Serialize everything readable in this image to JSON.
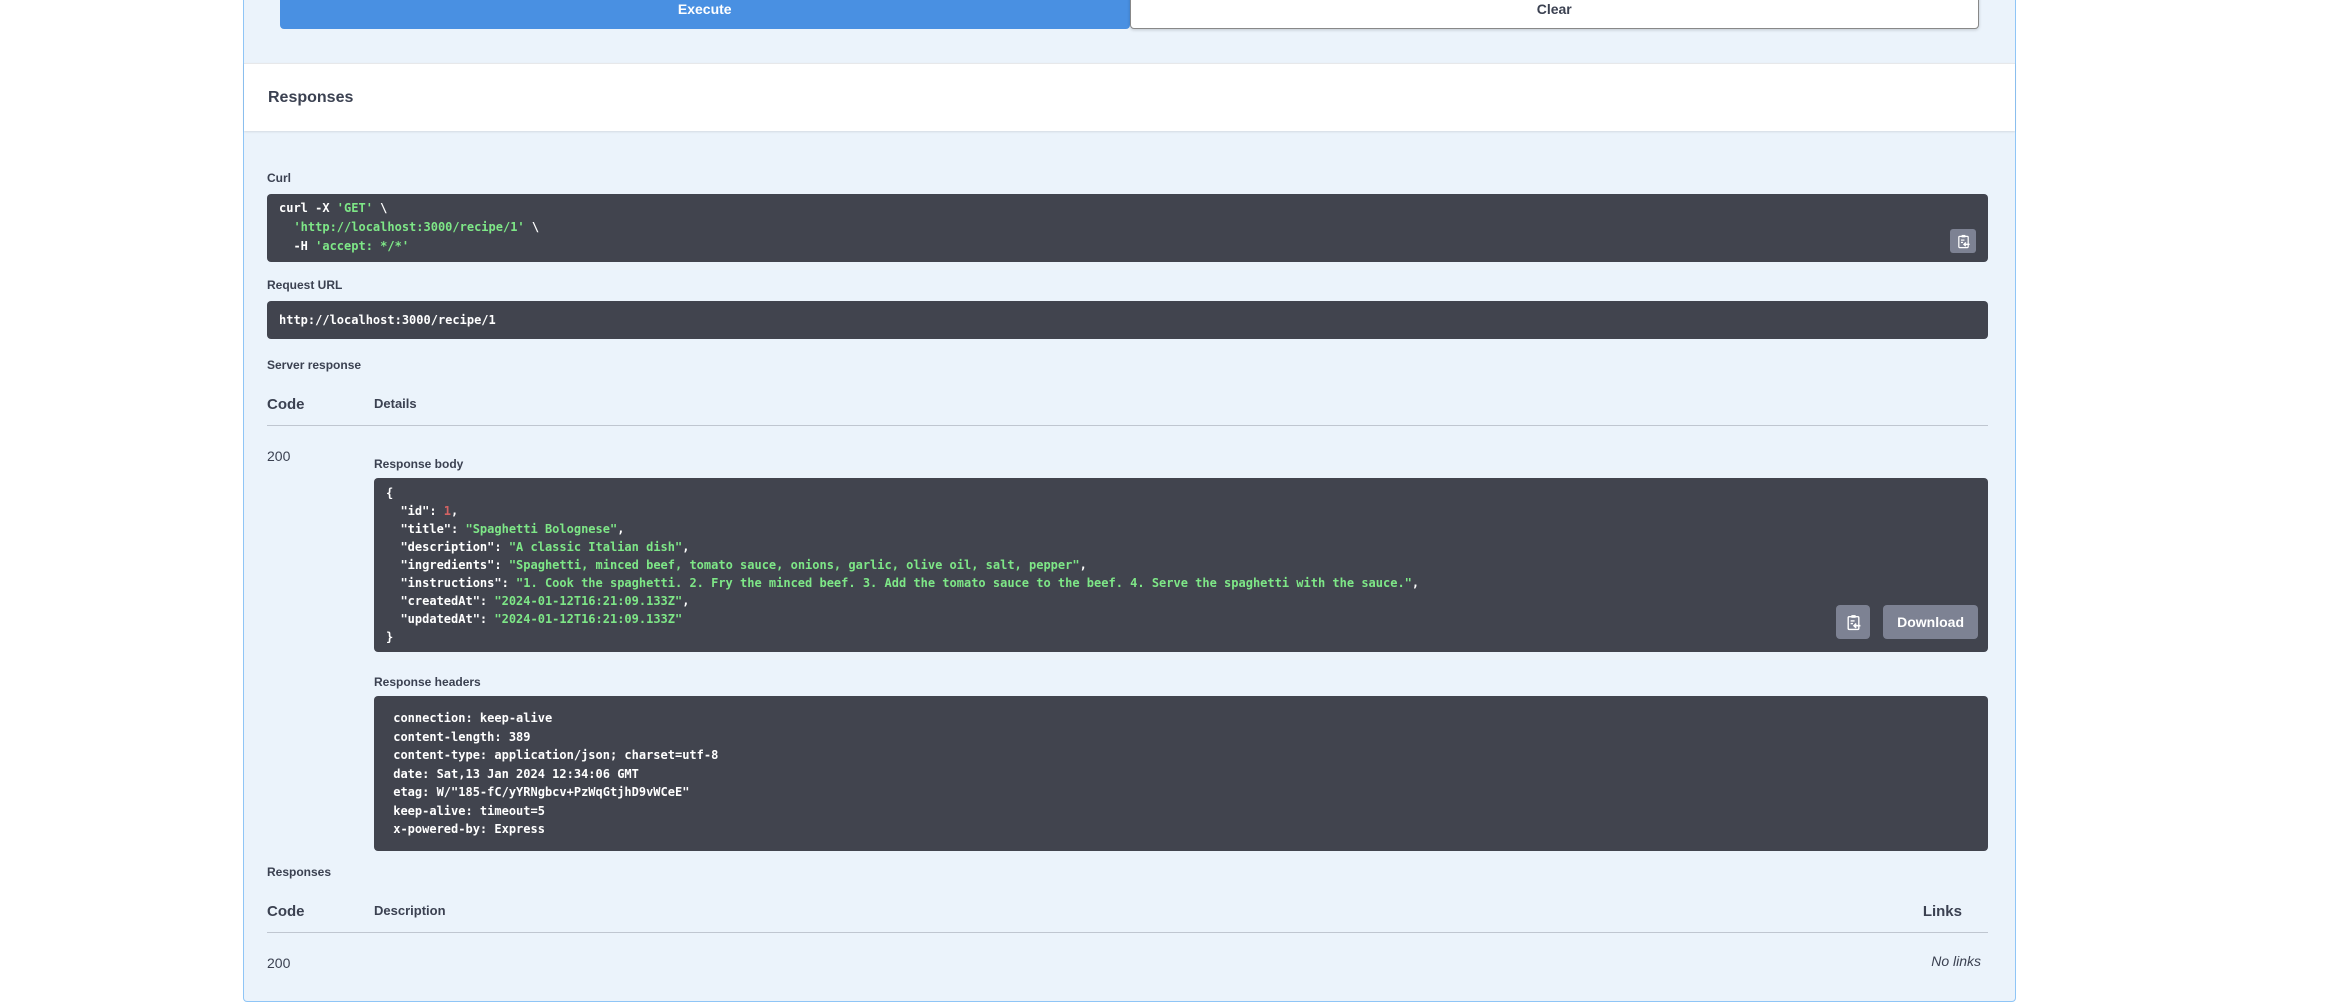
{
  "actions": {
    "execute_label": "Execute",
    "clear_label": "Clear"
  },
  "responses_section": {
    "title": "Responses"
  },
  "curl": {
    "label": "Curl",
    "code": [
      [
        [
          "w",
          "curl -X "
        ],
        [
          "g",
          "'GET'"
        ],
        [
          "w",
          " \\"
        ]
      ],
      [
        [
          "w",
          "  "
        ],
        [
          "g",
          "'http://localhost:3000/recipe/1'"
        ],
        [
          "w",
          " \\"
        ]
      ],
      [
        [
          "w",
          "  -H "
        ],
        [
          "g",
          "'accept: */*'"
        ]
      ]
    ]
  },
  "request_url": {
    "label": "Request URL",
    "value": "http://localhost:3000/recipe/1"
  },
  "server_response": {
    "label": "Server response",
    "table": {
      "code_header": "Code",
      "details_header": "Details"
    },
    "row": {
      "code": "200"
    },
    "response_body": {
      "label": "Response body",
      "download_label": "Download",
      "code": [
        [
          [
            "w",
            "{"
          ]
        ],
        [
          [
            "w",
            "  \"id\": "
          ],
          [
            "r",
            "1"
          ],
          [
            "w",
            ","
          ]
        ],
        [
          [
            "w",
            "  \"title\": "
          ],
          [
            "g",
            "\"Spaghetti Bolognese\""
          ],
          [
            "w",
            ","
          ]
        ],
        [
          [
            "w",
            "  \"description\": "
          ],
          [
            "g",
            "\"A classic Italian dish\""
          ],
          [
            "w",
            ","
          ]
        ],
        [
          [
            "w",
            "  \"ingredients\": "
          ],
          [
            "g",
            "\"Spaghetti, minced beef, tomato sauce, onions, garlic, olive oil, salt, pepper\""
          ],
          [
            "w",
            ","
          ]
        ],
        [
          [
            "w",
            "  \"instructions\": "
          ],
          [
            "g",
            "\"1. Cook the spaghetti. 2. Fry the minced beef. 3. Add the tomato sauce to the beef. 4. Serve the spaghetti with the sauce.\""
          ],
          [
            "w",
            ","
          ]
        ],
        [
          [
            "w",
            "  \"createdAt\": "
          ],
          [
            "g",
            "\"2024-01-12T16:21:09.133Z\""
          ],
          [
            "w",
            ","
          ]
        ],
        [
          [
            "w",
            "  \"updatedAt\": "
          ],
          [
            "g",
            "\"2024-01-12T16:21:09.133Z\""
          ]
        ],
        [
          [
            "w",
            "}"
          ]
        ]
      ]
    },
    "response_headers": {
      "label": "Response headers",
      "code": [
        " connection: keep-alive ",
        " content-length: 389 ",
        " content-type: application/json; charset=utf-8 ",
        " date: Sat,13 Jan 2024 12:34:06 GMT ",
        " etag: W/\"185-fC/yYRNgbcv+PzWqGtjhD9vWCeE\" ",
        " keep-alive: timeout=5 ",
        " x-powered-by: Express "
      ]
    }
  },
  "responses_doc": {
    "label": "Responses",
    "table": {
      "code_header": "Code",
      "description_header": "Description",
      "links_header": "Links"
    },
    "rows": [
      {
        "code": "200",
        "description": "",
        "links": "No links"
      }
    ]
  },
  "colors": {
    "execute_blue": "#4990e2",
    "code_bg": "#41444e",
    "string_green": "#7ee787",
    "number_red": "#d36363",
    "panel_bg": "#ebf3fb",
    "panel_border": "#8fc5f6",
    "button_gray": "#7d8293",
    "text_dark": "#3b4151"
  }
}
